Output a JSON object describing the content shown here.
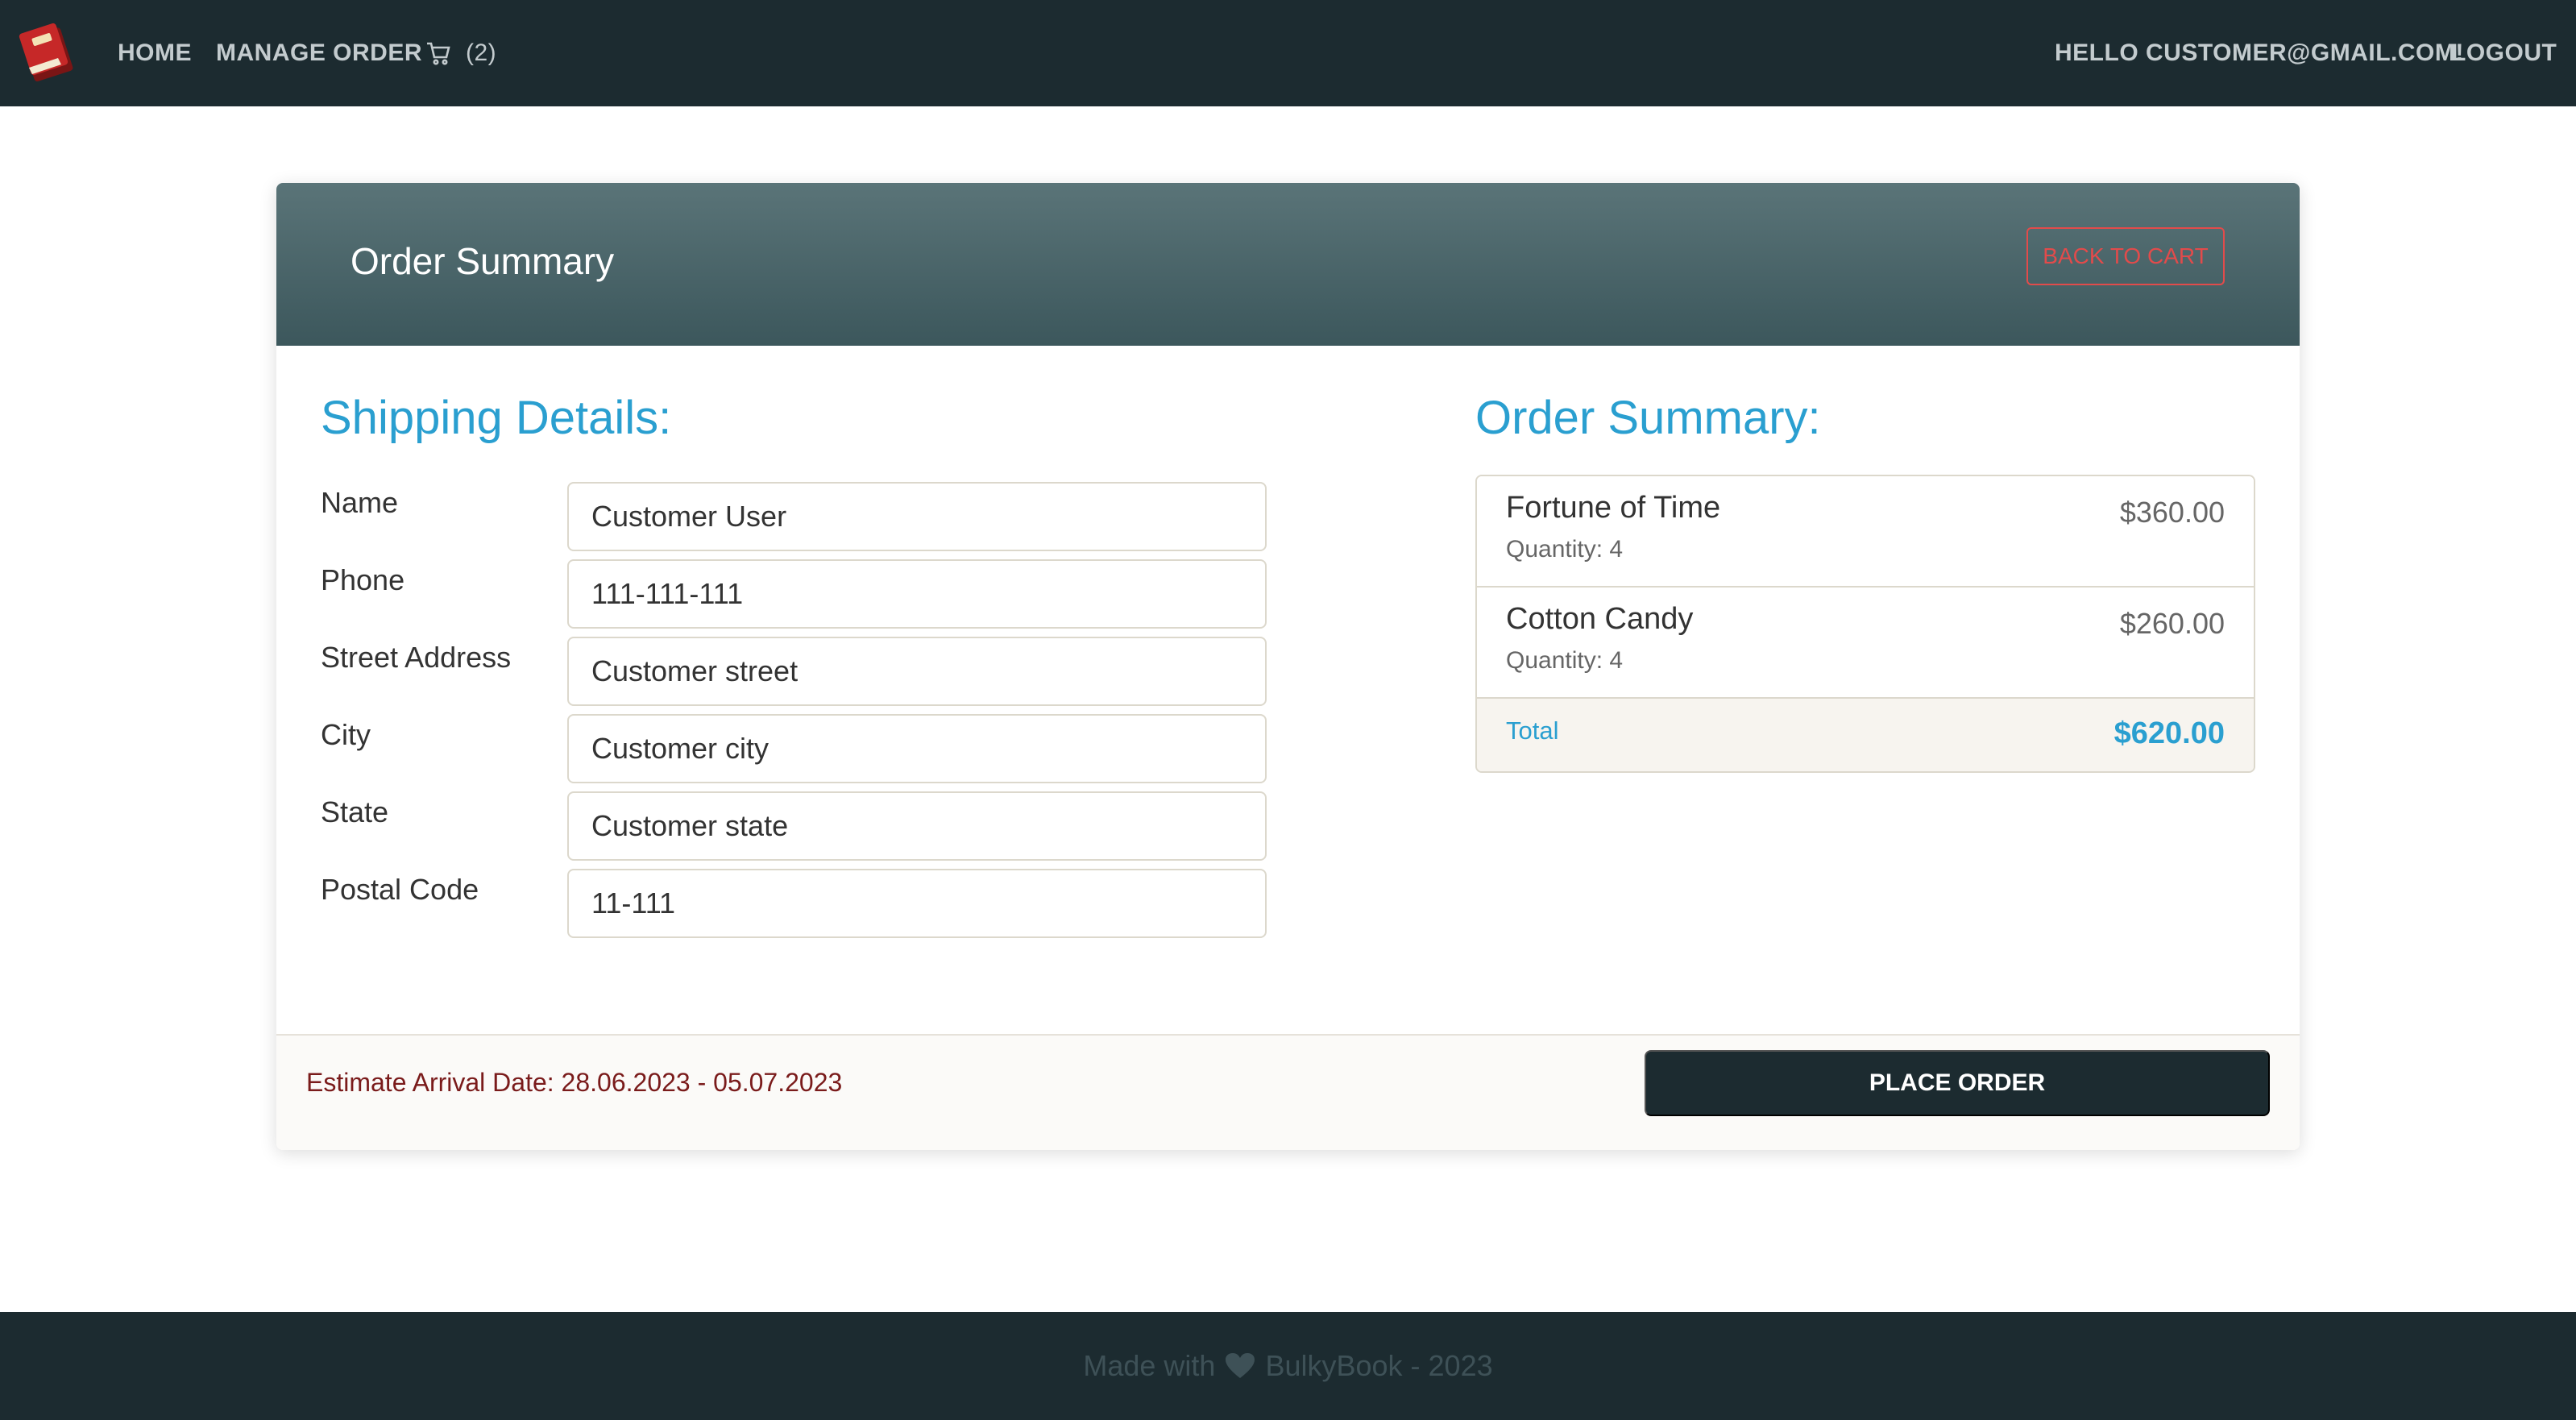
{
  "nav": {
    "home": "HOME",
    "manage_order": "MANAGE ORDER",
    "cart_count": "(2)",
    "hello": "HELLO CUSTOMER@GMAIL.COM!",
    "logout": "LOGOUT"
  },
  "card": {
    "title": "Order Summary",
    "back_to_cart": "BACK TO CART"
  },
  "shipping": {
    "title": "Shipping Details:",
    "fields": [
      {
        "label": "Name",
        "value": "Customer User"
      },
      {
        "label": "Phone",
        "value": "111-111-111"
      },
      {
        "label": "Street Address",
        "value": "Customer street"
      },
      {
        "label": "City",
        "value": "Customer city"
      },
      {
        "label": "State",
        "value": "Customer state"
      },
      {
        "label": "Postal Code",
        "value": "11-111"
      }
    ]
  },
  "summary": {
    "title": "Order Summary:",
    "items": [
      {
        "name": "Fortune of Time",
        "quantity": "Quantity: 4",
        "price": "$360.00"
      },
      {
        "name": "Cotton Candy",
        "quantity": "Quantity: 4",
        "price": "$260.00"
      }
    ],
    "total_label": "Total",
    "total_value": "$620.00"
  },
  "footer_bar": {
    "eta": "Estimate Arrival Date: 28.06.2023 - 05.07.2023",
    "place_order": "PLACE ORDER"
  },
  "site_footer": {
    "made_with": "Made with",
    "brand": "BulkyBook - 2023"
  },
  "icons": {
    "logo": "red-book-icon",
    "cart": "cart-icon",
    "heart": "heart-icon"
  },
  "colors": {
    "navbar": "#1c2b30",
    "accent": "#2a9fd0",
    "danger": "#e24b4b",
    "eta": "#7a1b1b"
  }
}
